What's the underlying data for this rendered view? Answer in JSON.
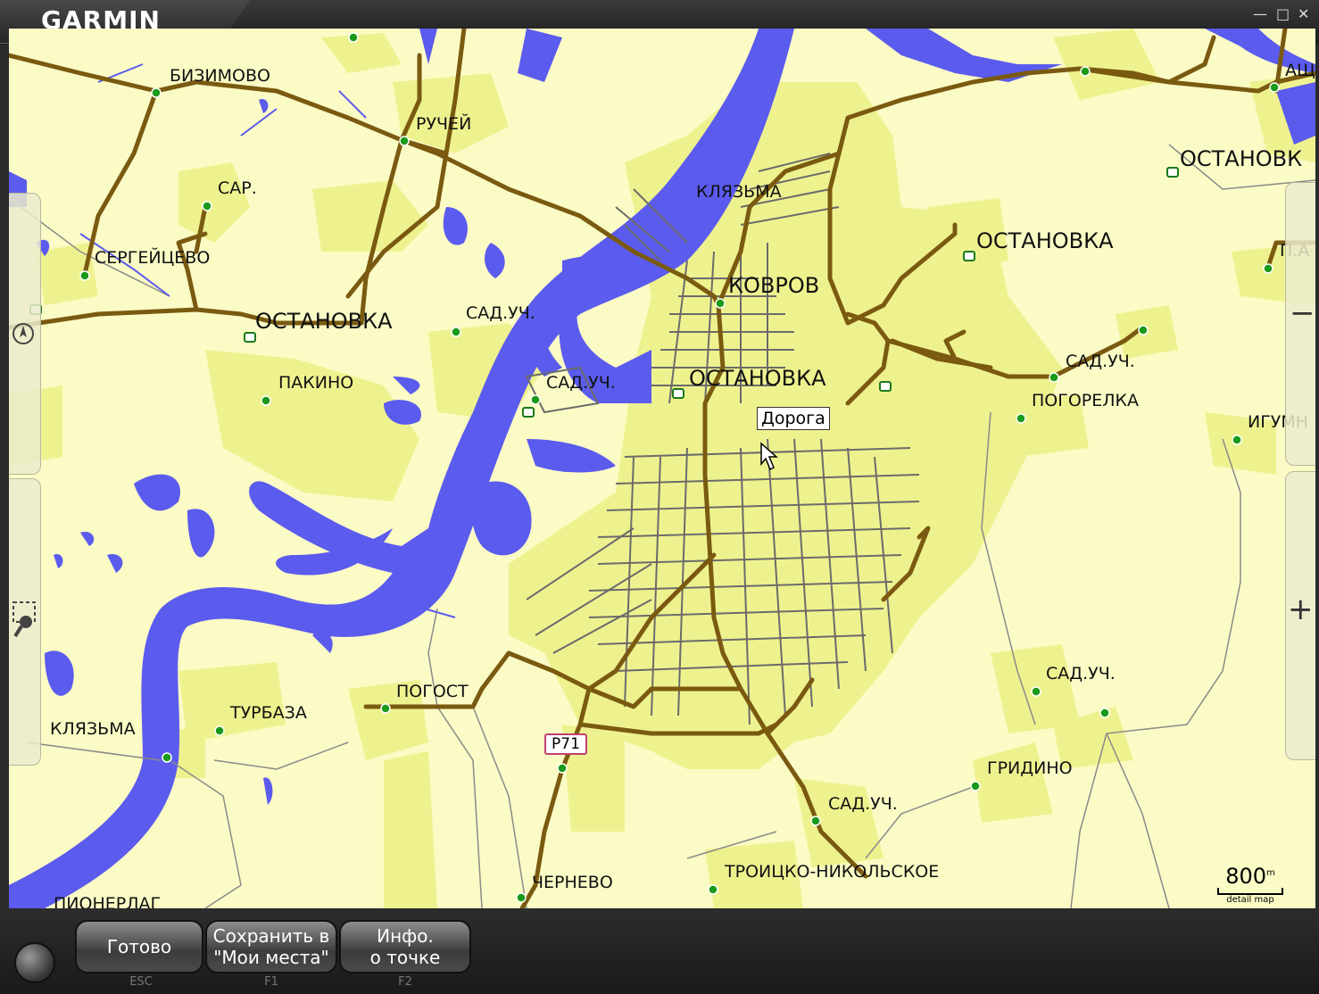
{
  "app": {
    "logo": "GARMIN",
    "logo_tm": "™"
  },
  "window_controls": {
    "minimize": "—",
    "restore": "□",
    "close": "✕"
  },
  "map": {
    "labels": {
      "bizimovo": "БИЗИМОВО",
      "ruchey": "РУЧЕЙ",
      "sar": "САР.",
      "sergeytsevo": "СЕРГЕЙЦЕВО",
      "ostanovka_w": "ОСТАНОВКА",
      "pakino": "ПАКИНО",
      "sad_1": "САД.УЧ.",
      "sad_2": "САД.УЧ.",
      "klyazma_n": "КЛЯЗЬМА",
      "kovrov": "КОВРОВ",
      "ostanovka_c": "ОСТАНОВКА",
      "ostanovka_e": "ОСТАНОВКА",
      "ostanovka_ne": "ОСТАНОВК",
      "ash": "АЩ",
      "p": "П.А",
      "sad_e": "САД.УЧ.",
      "pogorelka": "ПОГОРЕЛКА",
      "igumn": "ИГУМН",
      "sad_se": "САД.УЧ.",
      "gridino": "ГРИДИНО",
      "sad_s": "САД.УЧ.",
      "troitsko": "ТРОИЦКО-НИКОЛЬСКОЕ",
      "chernevo": "ЧЕРНЕВО",
      "pogost": "ПОГОСТ",
      "turbaza": "ТУРБАЗА",
      "klyazma_w": "КЛЯЗЬМА",
      "pionerlag": "ПИОНЕРЛАГ"
    },
    "tooltip": "Дорога",
    "route_shield": "Р71",
    "scale": {
      "value": "800",
      "unit": "m",
      "caption": "detail map"
    },
    "colors": {
      "land": "#fbfbc6",
      "urban": "#eef28e",
      "water": "#5b5bee",
      "road": "#7a5a10",
      "street": "#6b6b6b",
      "poi": "#1a9a1a"
    }
  },
  "side_controls": {
    "zoom_out": "−",
    "zoom_in": "+",
    "compass": "compass-icon",
    "find": "magnifier-icon"
  },
  "toolbar": {
    "done_label": "Готово",
    "done_key": "ESC",
    "save_label_1": "Сохранить в",
    "save_label_2": "\"Мои места\"",
    "save_key": "F1",
    "info_label_1": "Инфо.",
    "info_label_2": "о точке",
    "info_key": "F2"
  }
}
